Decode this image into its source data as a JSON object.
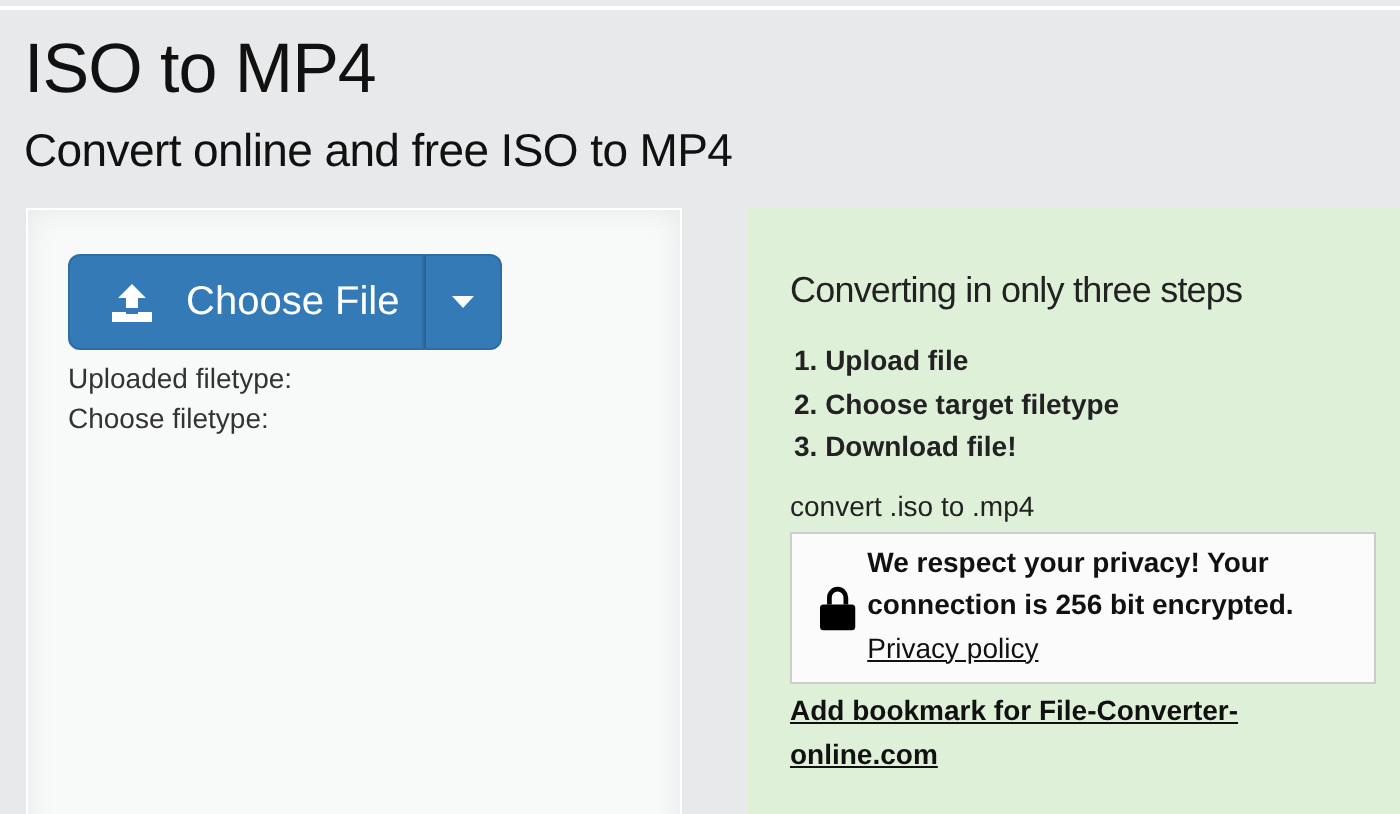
{
  "header": {
    "title": "ISO to MP4",
    "subtitle": "Convert online and free ISO to MP4"
  },
  "upload_panel": {
    "button": "Choose File",
    "fields": [
      "Uploaded filetype:",
      "Choose filetype:"
    ]
  },
  "info_panel": {
    "heading": "Converting in only three steps",
    "steps": [
      "1. Upload file",
      "2. Choose target filetype",
      "3. Download file!"
    ],
    "conversion": "convert .iso to .mp4",
    "privacy": {
      "text": "We respect your privacy! Your connection is 256 bit encrypted.",
      "link": "Privacy policy"
    },
    "bookmark_link": "Add bookmark for File-Converter-online.com"
  }
}
